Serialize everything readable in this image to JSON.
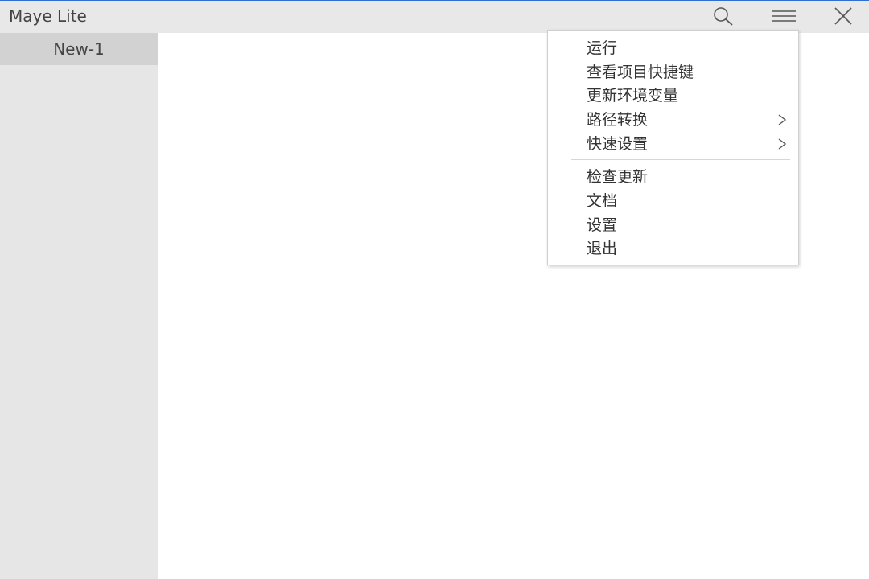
{
  "window": {
    "title": "Maye Lite",
    "accent_color": "#2f6fd0"
  },
  "titlebar": {
    "buttons": [
      {
        "icon": "search-icon"
      },
      {
        "icon": "hamburger-menu-icon"
      },
      {
        "icon": "close-icon"
      }
    ]
  },
  "sidebar": {
    "items": [
      {
        "label": "New-1",
        "selected": true
      }
    ]
  },
  "menu": {
    "items": [
      {
        "label": "运行",
        "submenu": false
      },
      {
        "label": "查看项目快捷键",
        "submenu": false
      },
      {
        "label": "更新环境变量",
        "submenu": false
      },
      {
        "label": "路径转换",
        "submenu": true,
        "arrow": ">"
      },
      {
        "label": "快速设置",
        "submenu": true,
        "arrow": ">"
      },
      {
        "label": "检查更新",
        "submenu": false
      },
      {
        "label": "文档",
        "submenu": false
      },
      {
        "label": "设置",
        "submenu": false
      },
      {
        "label": "退出",
        "submenu": false
      }
    ]
  }
}
